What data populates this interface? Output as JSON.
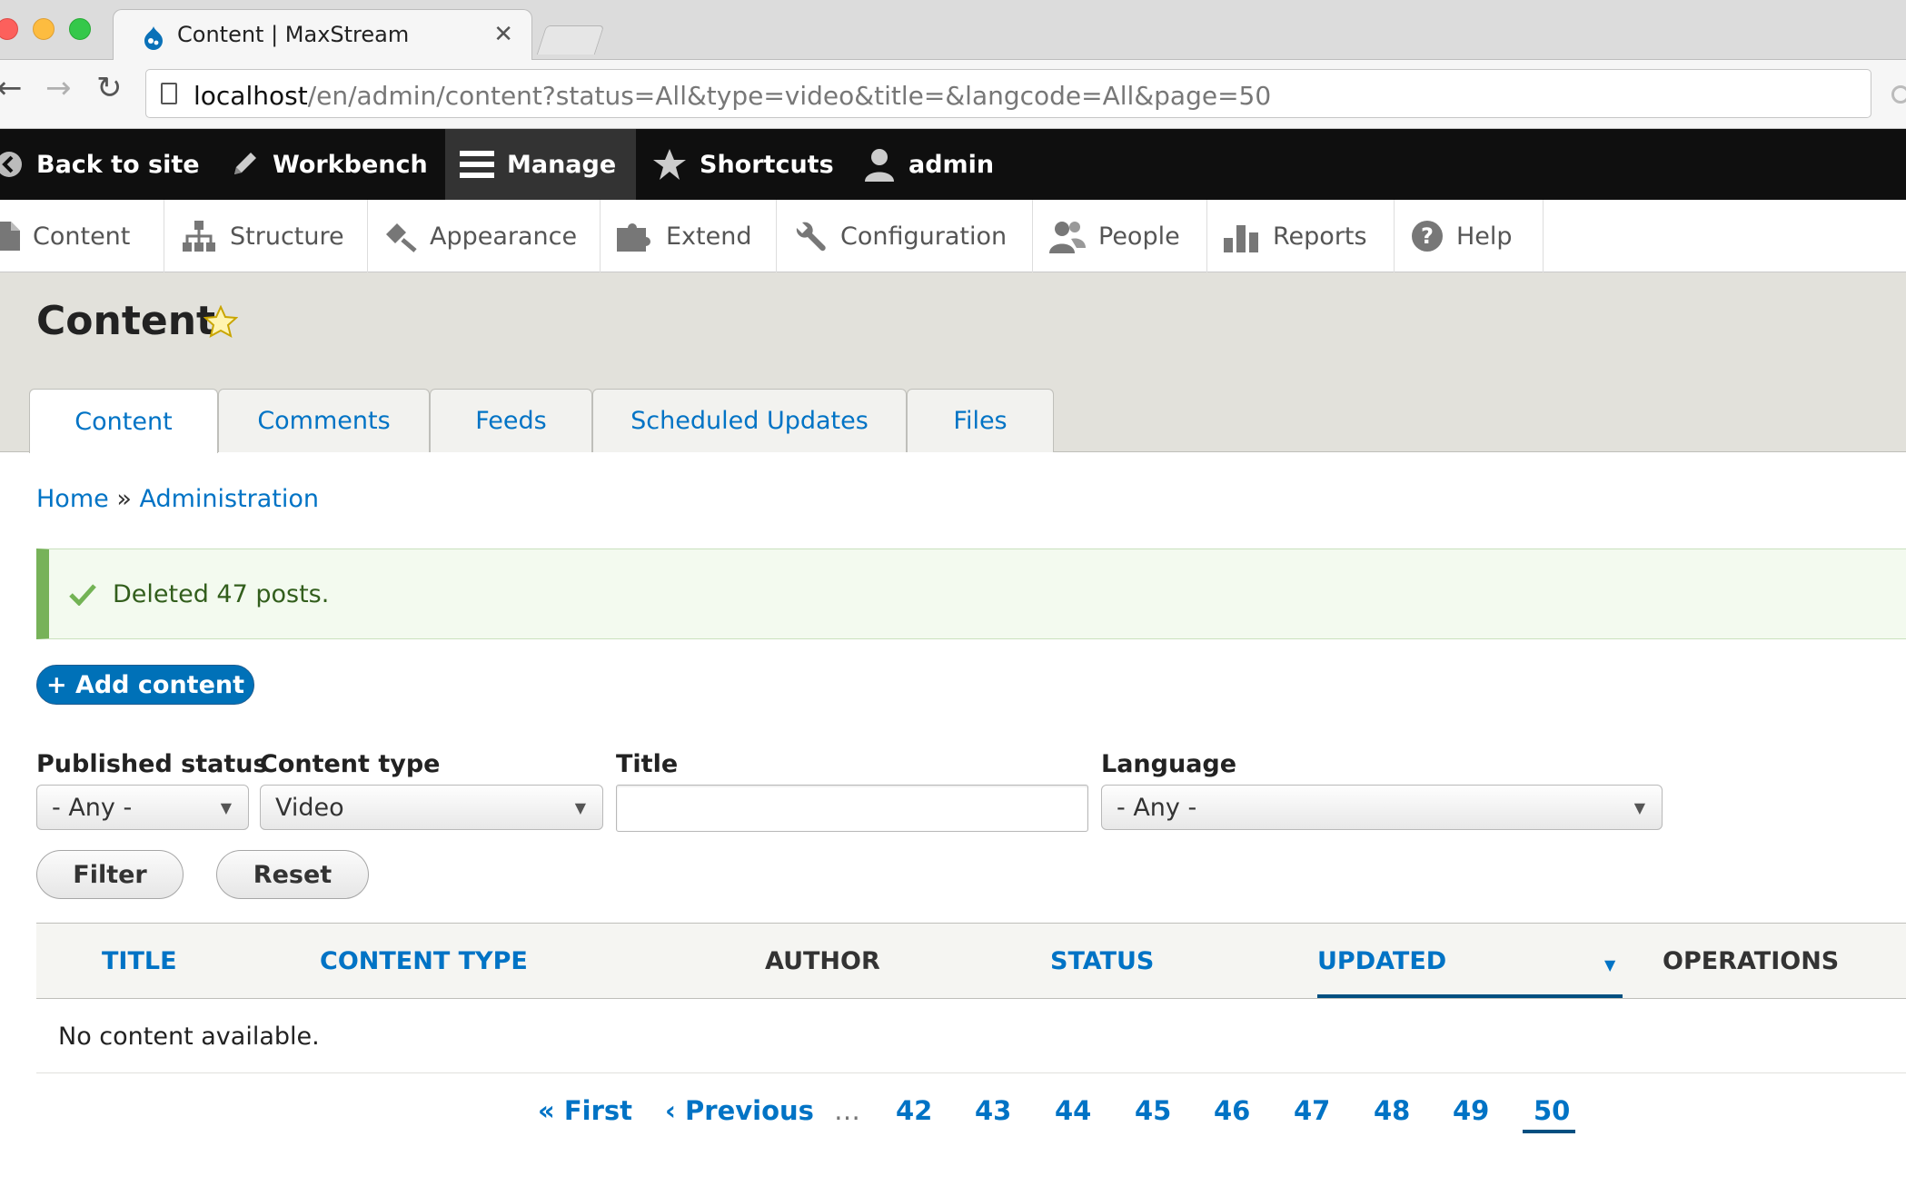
{
  "browser": {
    "tab_title": "Content | MaxStream",
    "url_host": "localhost",
    "url_path": "/en/admin/content?status=All&type=video&title=&langcode=All&page=50"
  },
  "admin_toolbar": {
    "items": [
      {
        "label": "Back to site",
        "icon": "back-arrow-icon"
      },
      {
        "label": "Workbench",
        "icon": "pencil-icon"
      },
      {
        "label": "Manage",
        "icon": "menu-icon"
      },
      {
        "label": "Shortcuts",
        "icon": "star-icon"
      },
      {
        "label": "admin",
        "icon": "user-icon"
      }
    ]
  },
  "admin_tray": {
    "items": [
      {
        "label": "Content",
        "icon": "file-icon"
      },
      {
        "label": "Structure",
        "icon": "sitemap-icon"
      },
      {
        "label": "Appearance",
        "icon": "brush-icon"
      },
      {
        "label": "Extend",
        "icon": "puzzle-icon"
      },
      {
        "label": "Configuration",
        "icon": "wrench-icon"
      },
      {
        "label": "People",
        "icon": "people-icon"
      },
      {
        "label": "Reports",
        "icon": "bar-chart-icon"
      },
      {
        "label": "Help",
        "icon": "help-icon"
      }
    ]
  },
  "page": {
    "title": "Content",
    "tabs": [
      "Content",
      "Comments",
      "Feeds",
      "Scheduled Updates",
      "Files"
    ],
    "active_tab": "Content"
  },
  "breadcrumb": {
    "home": "Home",
    "separator": "»",
    "admin": "Administration"
  },
  "message": {
    "text": "Deleted 47 posts.",
    "color": "#77b259"
  },
  "actions": {
    "add_content": "+ Add content"
  },
  "filters": {
    "published_status": {
      "label": "Published status",
      "value": "- Any -"
    },
    "content_type": {
      "label": "Content type",
      "value": "Video"
    },
    "title": {
      "label": "Title",
      "value": ""
    },
    "language": {
      "label": "Language",
      "value": "- Any -"
    },
    "filter_button": "Filter",
    "reset_button": "Reset"
  },
  "table": {
    "columns": [
      "Title",
      "Content type",
      "Author",
      "Status",
      "Updated",
      "Operations"
    ],
    "sorted_by": "Updated",
    "empty_text": "No content available."
  },
  "pager": {
    "first": "« First",
    "previous": "‹ Previous",
    "ellipsis": "…",
    "pages": [
      "42",
      "43",
      "44",
      "45",
      "46",
      "47",
      "48",
      "49",
      "50"
    ],
    "current": "50"
  },
  "colors": {
    "link": "#0073c5",
    "toolbar_bg": "#0f0f0f",
    "primary_button": "#0071b8"
  }
}
